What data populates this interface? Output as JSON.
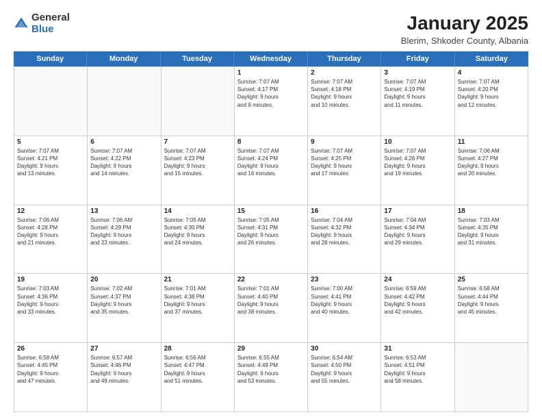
{
  "logo": {
    "general": "General",
    "blue": "Blue"
  },
  "header": {
    "title": "January 2025",
    "location": "Blerim, Shkoder County, Albania"
  },
  "weekdays": [
    "Sunday",
    "Monday",
    "Tuesday",
    "Wednesday",
    "Thursday",
    "Friday",
    "Saturday"
  ],
  "weeks": [
    [
      {
        "day": "",
        "info": ""
      },
      {
        "day": "",
        "info": ""
      },
      {
        "day": "",
        "info": ""
      },
      {
        "day": "1",
        "info": "Sunrise: 7:07 AM\nSunset: 4:17 PM\nDaylight: 9 hours\nand 9 minutes."
      },
      {
        "day": "2",
        "info": "Sunrise: 7:07 AM\nSunset: 4:18 PM\nDaylight: 9 hours\nand 10 minutes."
      },
      {
        "day": "3",
        "info": "Sunrise: 7:07 AM\nSunset: 4:19 PM\nDaylight: 9 hours\nand 11 minutes."
      },
      {
        "day": "4",
        "info": "Sunrise: 7:07 AM\nSunset: 4:20 PM\nDaylight: 9 hours\nand 12 minutes."
      }
    ],
    [
      {
        "day": "5",
        "info": "Sunrise: 7:07 AM\nSunset: 4:21 PM\nDaylight: 9 hours\nand 13 minutes."
      },
      {
        "day": "6",
        "info": "Sunrise: 7:07 AM\nSunset: 4:22 PM\nDaylight: 9 hours\nand 14 minutes."
      },
      {
        "day": "7",
        "info": "Sunrise: 7:07 AM\nSunset: 4:23 PM\nDaylight: 9 hours\nand 15 minutes."
      },
      {
        "day": "8",
        "info": "Sunrise: 7:07 AM\nSunset: 4:24 PM\nDaylight: 9 hours\nand 16 minutes."
      },
      {
        "day": "9",
        "info": "Sunrise: 7:07 AM\nSunset: 4:25 PM\nDaylight: 9 hours\nand 17 minutes."
      },
      {
        "day": "10",
        "info": "Sunrise: 7:07 AM\nSunset: 4:26 PM\nDaylight: 9 hours\nand 19 minutes."
      },
      {
        "day": "11",
        "info": "Sunrise: 7:06 AM\nSunset: 4:27 PM\nDaylight: 9 hours\nand 20 minutes."
      }
    ],
    [
      {
        "day": "12",
        "info": "Sunrise: 7:06 AM\nSunset: 4:28 PM\nDaylight: 9 hours\nand 21 minutes."
      },
      {
        "day": "13",
        "info": "Sunrise: 7:06 AM\nSunset: 4:29 PM\nDaylight: 9 hours\nand 23 minutes."
      },
      {
        "day": "14",
        "info": "Sunrise: 7:05 AM\nSunset: 4:30 PM\nDaylight: 9 hours\nand 24 minutes."
      },
      {
        "day": "15",
        "info": "Sunrise: 7:05 AM\nSunset: 4:31 PM\nDaylight: 9 hours\nand 26 minutes."
      },
      {
        "day": "16",
        "info": "Sunrise: 7:04 AM\nSunset: 4:32 PM\nDaylight: 9 hours\nand 28 minutes."
      },
      {
        "day": "17",
        "info": "Sunrise: 7:04 AM\nSunset: 4:34 PM\nDaylight: 9 hours\nand 29 minutes."
      },
      {
        "day": "18",
        "info": "Sunrise: 7:03 AM\nSunset: 4:35 PM\nDaylight: 9 hours\nand 31 minutes."
      }
    ],
    [
      {
        "day": "19",
        "info": "Sunrise: 7:03 AM\nSunset: 4:36 PM\nDaylight: 9 hours\nand 33 minutes."
      },
      {
        "day": "20",
        "info": "Sunrise: 7:02 AM\nSunset: 4:37 PM\nDaylight: 9 hours\nand 35 minutes."
      },
      {
        "day": "21",
        "info": "Sunrise: 7:01 AM\nSunset: 4:38 PM\nDaylight: 9 hours\nand 37 minutes."
      },
      {
        "day": "22",
        "info": "Sunrise: 7:01 AM\nSunset: 4:40 PM\nDaylight: 9 hours\nand 38 minutes."
      },
      {
        "day": "23",
        "info": "Sunrise: 7:00 AM\nSunset: 4:41 PM\nDaylight: 9 hours\nand 40 minutes."
      },
      {
        "day": "24",
        "info": "Sunrise: 6:59 AM\nSunset: 4:42 PM\nDaylight: 9 hours\nand 42 minutes."
      },
      {
        "day": "25",
        "info": "Sunrise: 6:58 AM\nSunset: 4:44 PM\nDaylight: 9 hours\nand 45 minutes."
      }
    ],
    [
      {
        "day": "26",
        "info": "Sunrise: 6:58 AM\nSunset: 4:45 PM\nDaylight: 9 hours\nand 47 minutes."
      },
      {
        "day": "27",
        "info": "Sunrise: 6:57 AM\nSunset: 4:46 PM\nDaylight: 9 hours\nand 49 minutes."
      },
      {
        "day": "28",
        "info": "Sunrise: 6:56 AM\nSunset: 4:47 PM\nDaylight: 9 hours\nand 51 minutes."
      },
      {
        "day": "29",
        "info": "Sunrise: 6:55 AM\nSunset: 4:49 PM\nDaylight: 9 hours\nand 53 minutes."
      },
      {
        "day": "30",
        "info": "Sunrise: 6:54 AM\nSunset: 4:50 PM\nDaylight: 9 hours\nand 55 minutes."
      },
      {
        "day": "31",
        "info": "Sunrise: 6:53 AM\nSunset: 4:51 PM\nDaylight: 9 hours\nand 58 minutes."
      },
      {
        "day": "",
        "info": ""
      }
    ]
  ]
}
